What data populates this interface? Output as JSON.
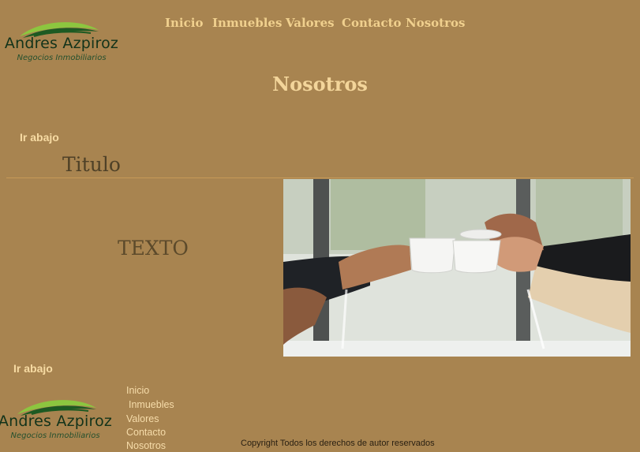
{
  "brand": {
    "name": "Andres Azpiroz",
    "tagline": "Negocios Inmobiliarios",
    "logo_colors": {
      "dark_green": "#1d5a22",
      "light_green": "#8cc63f",
      "text": "#12331a"
    }
  },
  "nav": {
    "items": [
      {
        "label": "Inicio"
      },
      {
        "label": "Inmuebles"
      },
      {
        "label": "Valores"
      },
      {
        "label": "Contacto"
      },
      {
        "label": "Nosotros"
      }
    ]
  },
  "page": {
    "title": "Nosotros",
    "jump_top": "Ir abajo",
    "section_title": "Titulo",
    "body_text": "TEXTO",
    "jump_bottom": "Ir abajo",
    "photo_icon": "coffee-toast-photo"
  },
  "footer": {
    "brand_name": "Andres Azpiroz",
    "brand_tagline": "Negocios Inmobiliarios",
    "nav": [
      {
        "label": "Inicio"
      },
      {
        "label": "Inmuebles"
      },
      {
        "label": "Valores"
      },
      {
        "label": "Contacto"
      },
      {
        "label": "Nosotros"
      }
    ],
    "copyright": "Copyright Todos los derechos de autor reservados"
  },
  "colors": {
    "background": "#a88450",
    "nav_text": "#f0d08e",
    "title_text": "#f3d59a",
    "divider": "#c79a58"
  }
}
